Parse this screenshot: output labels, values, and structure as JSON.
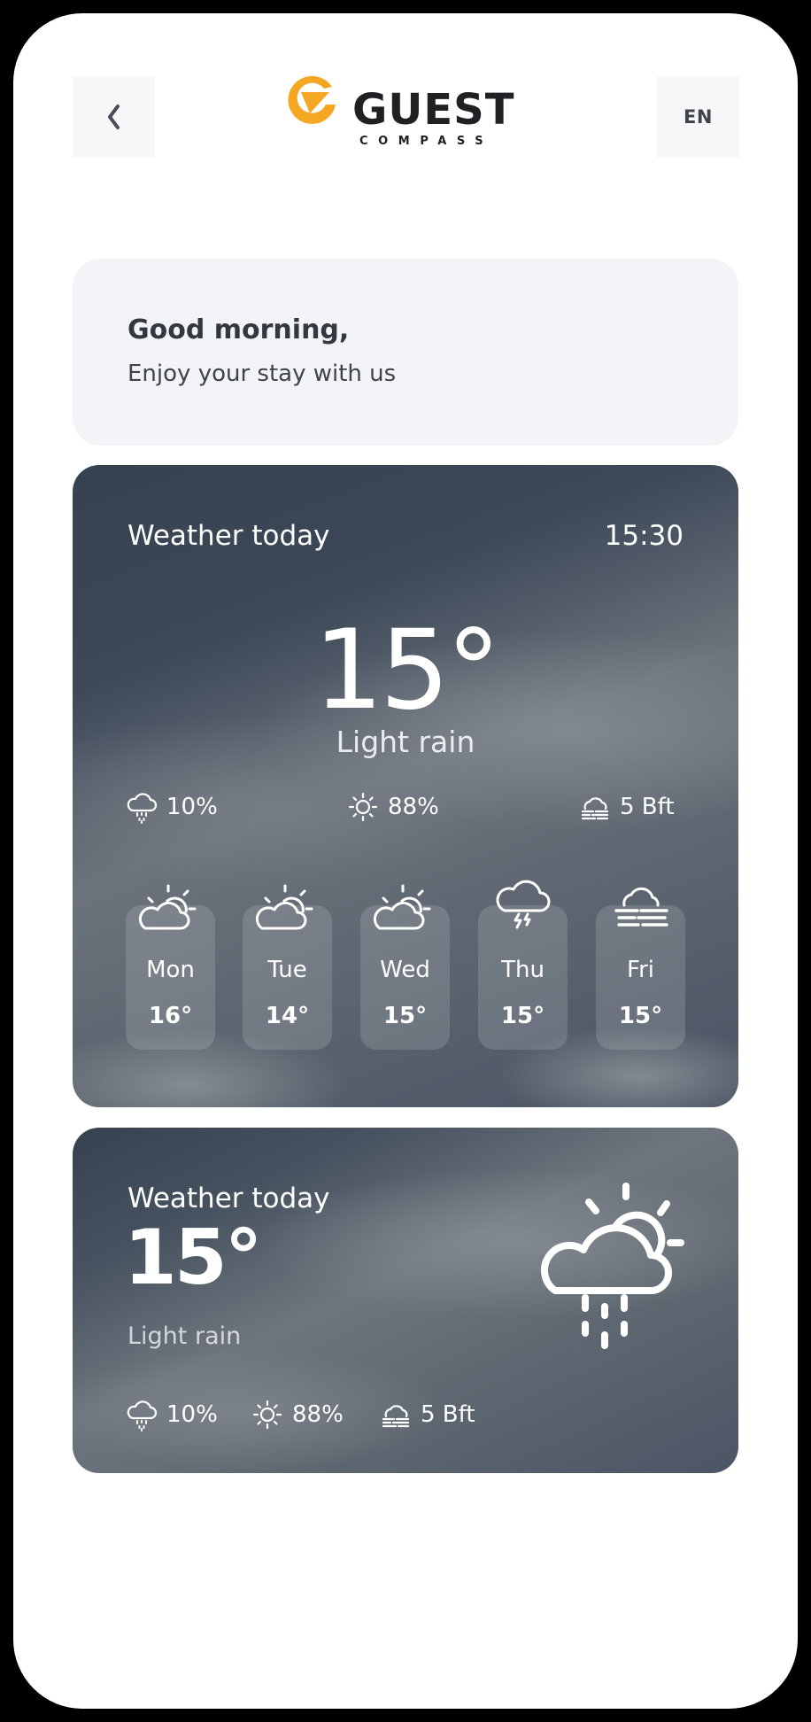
{
  "header": {
    "back_icon": "chevron-left-icon",
    "logo": {
      "word": "GUEST",
      "sub": "COMPASS",
      "accent_color": "#F5A623"
    },
    "language": "EN"
  },
  "greeting": {
    "title": "Good morning,",
    "subtitle": "Enjoy your stay with us"
  },
  "weather_card": {
    "title": "Weather today",
    "time": "15:30",
    "temperature": "15°",
    "condition": "Light rain",
    "stats": [
      {
        "icon": "rain-cloud-icon",
        "value": "10%"
      },
      {
        "icon": "sun-icon",
        "value": "88%"
      },
      {
        "icon": "wind-fog-icon",
        "value": "5 Bft"
      }
    ],
    "forecast": [
      {
        "day": "Mon",
        "temp": "16°",
        "icon": "partly-cloudy-icon"
      },
      {
        "day": "Tue",
        "temp": "14°",
        "icon": "partly-cloudy-icon"
      },
      {
        "day": "Wed",
        "temp": "15°",
        "icon": "partly-cloudy-icon"
      },
      {
        "day": "Thu",
        "temp": "15°",
        "icon": "thunderstorm-icon"
      },
      {
        "day": "Fri",
        "temp": "15°",
        "icon": "fog-icon"
      }
    ]
  },
  "weather_compact": {
    "title": "Weather today",
    "temperature": "15°",
    "condition": "Light rain",
    "icon": "sun-cloud-rain-icon",
    "stats": [
      {
        "icon": "rain-cloud-icon",
        "value": "10%"
      },
      {
        "icon": "sun-icon",
        "value": "88%"
      },
      {
        "icon": "wind-fog-icon",
        "value": "5 Bft"
      }
    ]
  }
}
